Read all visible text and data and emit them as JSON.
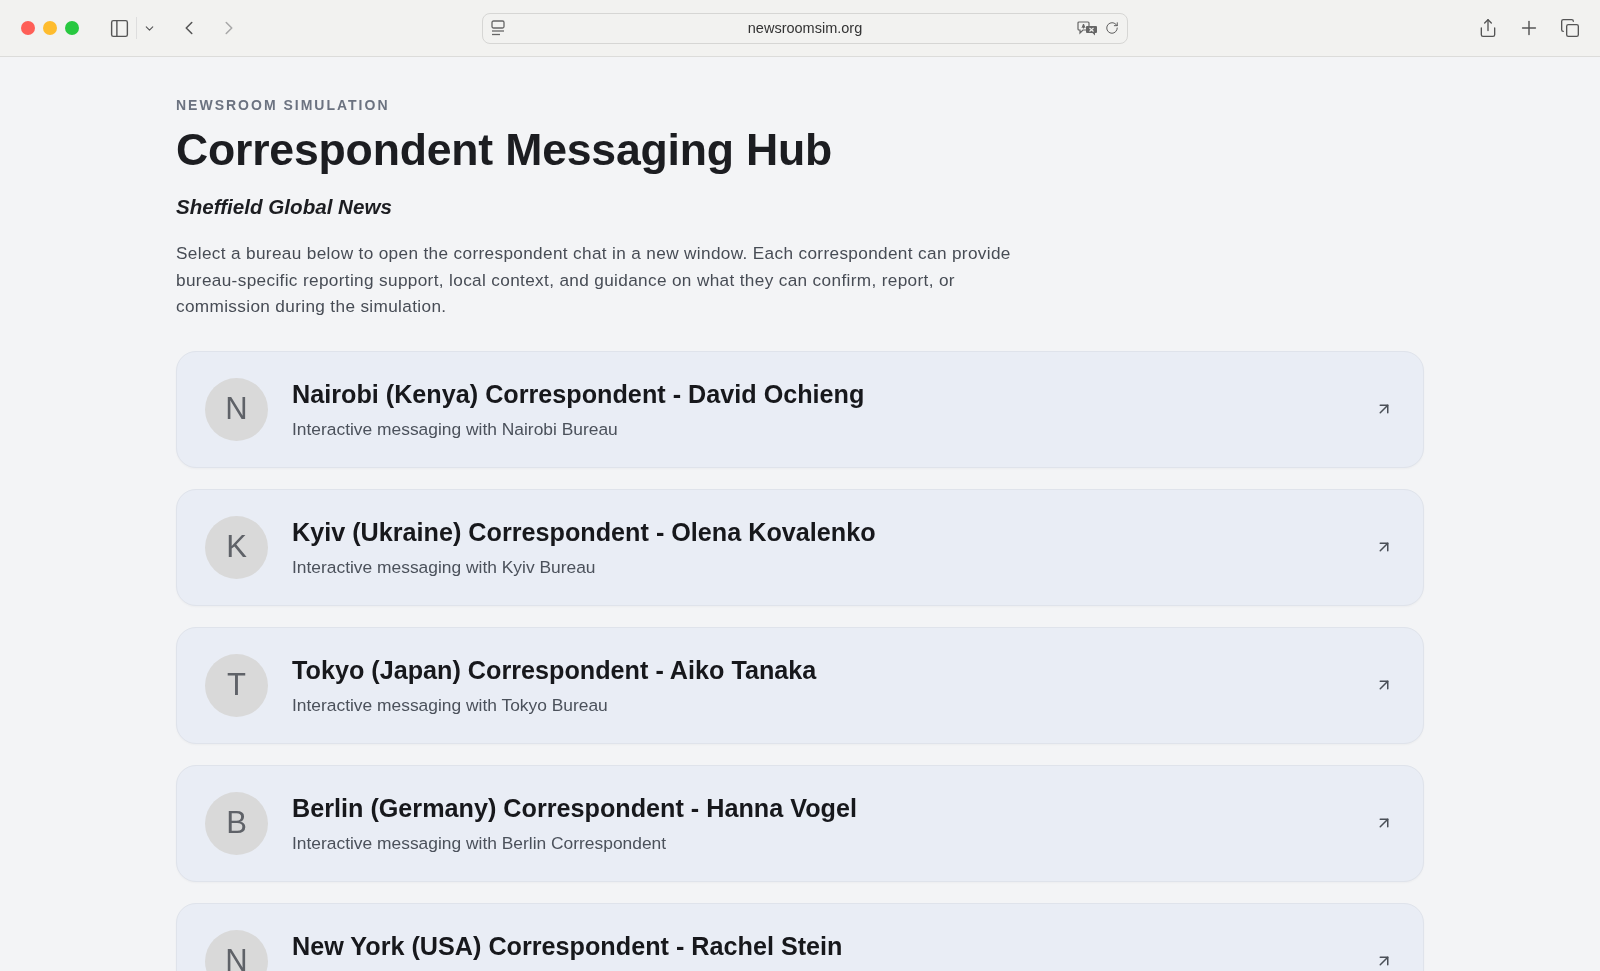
{
  "browser": {
    "url": "newsroomsim.org",
    "navigation": [
      {
        "kind": "back",
        "disabled": false
      },
      {
        "kind": "forward",
        "disabled": true
      }
    ]
  },
  "page": {
    "kicker": "NEWSROOM SIMULATION",
    "title": "Correspondent Messaging Hub",
    "subtitle": "Sheffield Global News",
    "intro": "Select a bureau below to open the correspondent chat in a new window. Each correspondent can provide bureau-specific reporting support, local context, and guidance on what they can confirm, report, or commission during the simulation."
  },
  "correspondents": [
    {
      "initial": "N",
      "title": "Nairobi (Kenya) Correspondent - David Ochieng",
      "description": "Interactive messaging with Nairobi Bureau"
    },
    {
      "initial": "K",
      "title": "Kyiv (Ukraine) Correspondent - Olena Kovalenko",
      "description": "Interactive messaging with Kyiv Bureau"
    },
    {
      "initial": "T",
      "title": "Tokyo (Japan) Correspondent - Aiko Tanaka",
      "description": "Interactive messaging with Tokyo Bureau"
    },
    {
      "initial": "B",
      "title": "Berlin (Germany) Correspondent - Hanna Vogel",
      "description": "Interactive messaging with Berlin Correspondent"
    },
    {
      "initial": "N",
      "title": "New York (USA) Correspondent - Rachel Stein"
    }
  ]
}
